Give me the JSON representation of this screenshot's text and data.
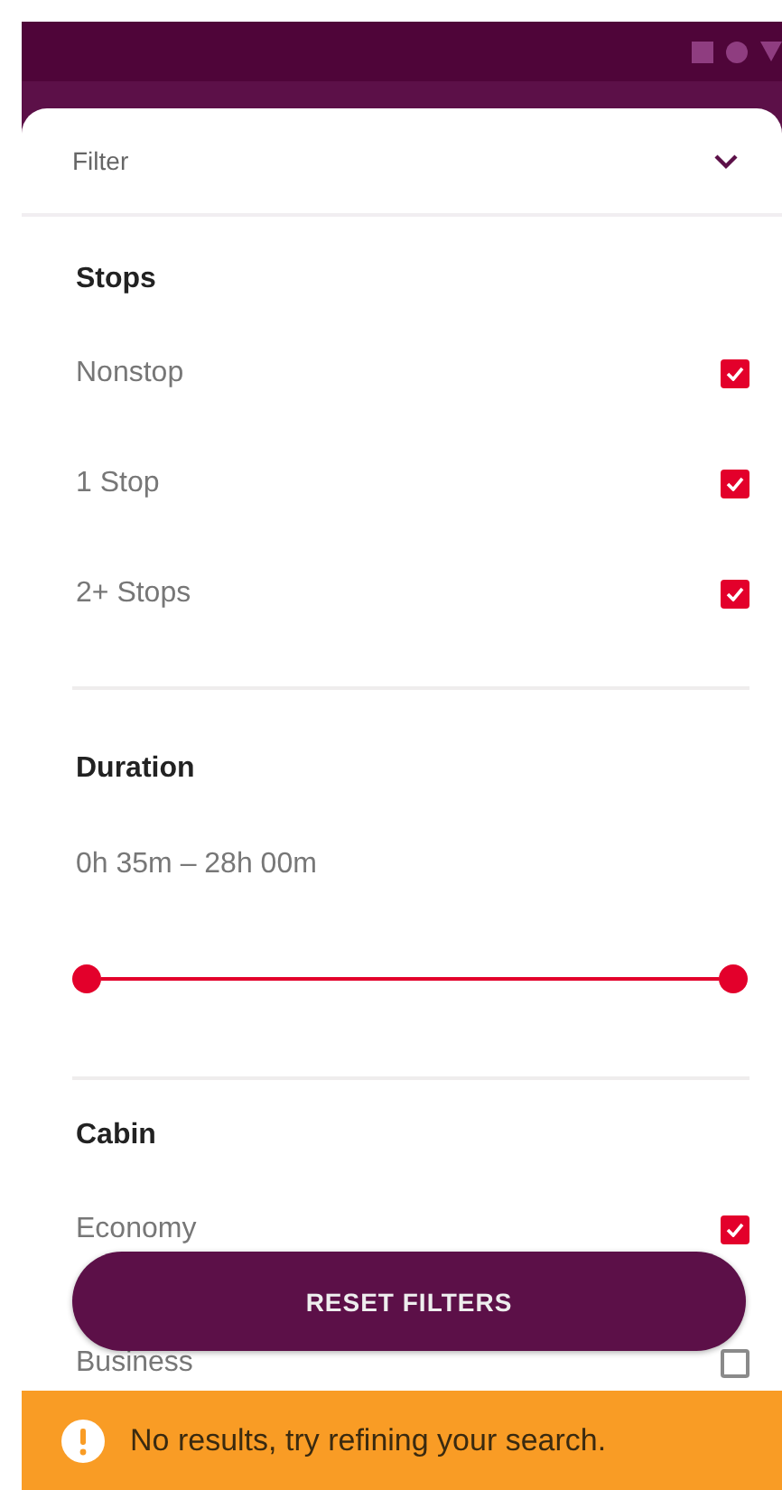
{
  "header": {
    "title": "Filter",
    "expanded": true
  },
  "sections": [
    {
      "title": "Stops",
      "kind": "checklist",
      "options": [
        {
          "label": "Nonstop",
          "checked": true
        },
        {
          "label": "1 Stop",
          "checked": true
        },
        {
          "label": "2+ Stops",
          "checked": true
        }
      ]
    },
    {
      "title": "Duration",
      "kind": "range",
      "reading": "0h 35m – 28h 00m",
      "handles": [
        {
          "level": 0
        },
        {
          "level": 1
        }
      ]
    },
    {
      "title": "Cabin",
      "kind": "checklist",
      "options": [
        {
          "label": "Economy",
          "checked": true
        },
        {
          "label": "Business",
          "checked": false
        }
      ]
    }
  ],
  "reset_button": {
    "label": "RESET FILTERS"
  },
  "alert": {
    "message": "No results, try refining your search."
  }
}
